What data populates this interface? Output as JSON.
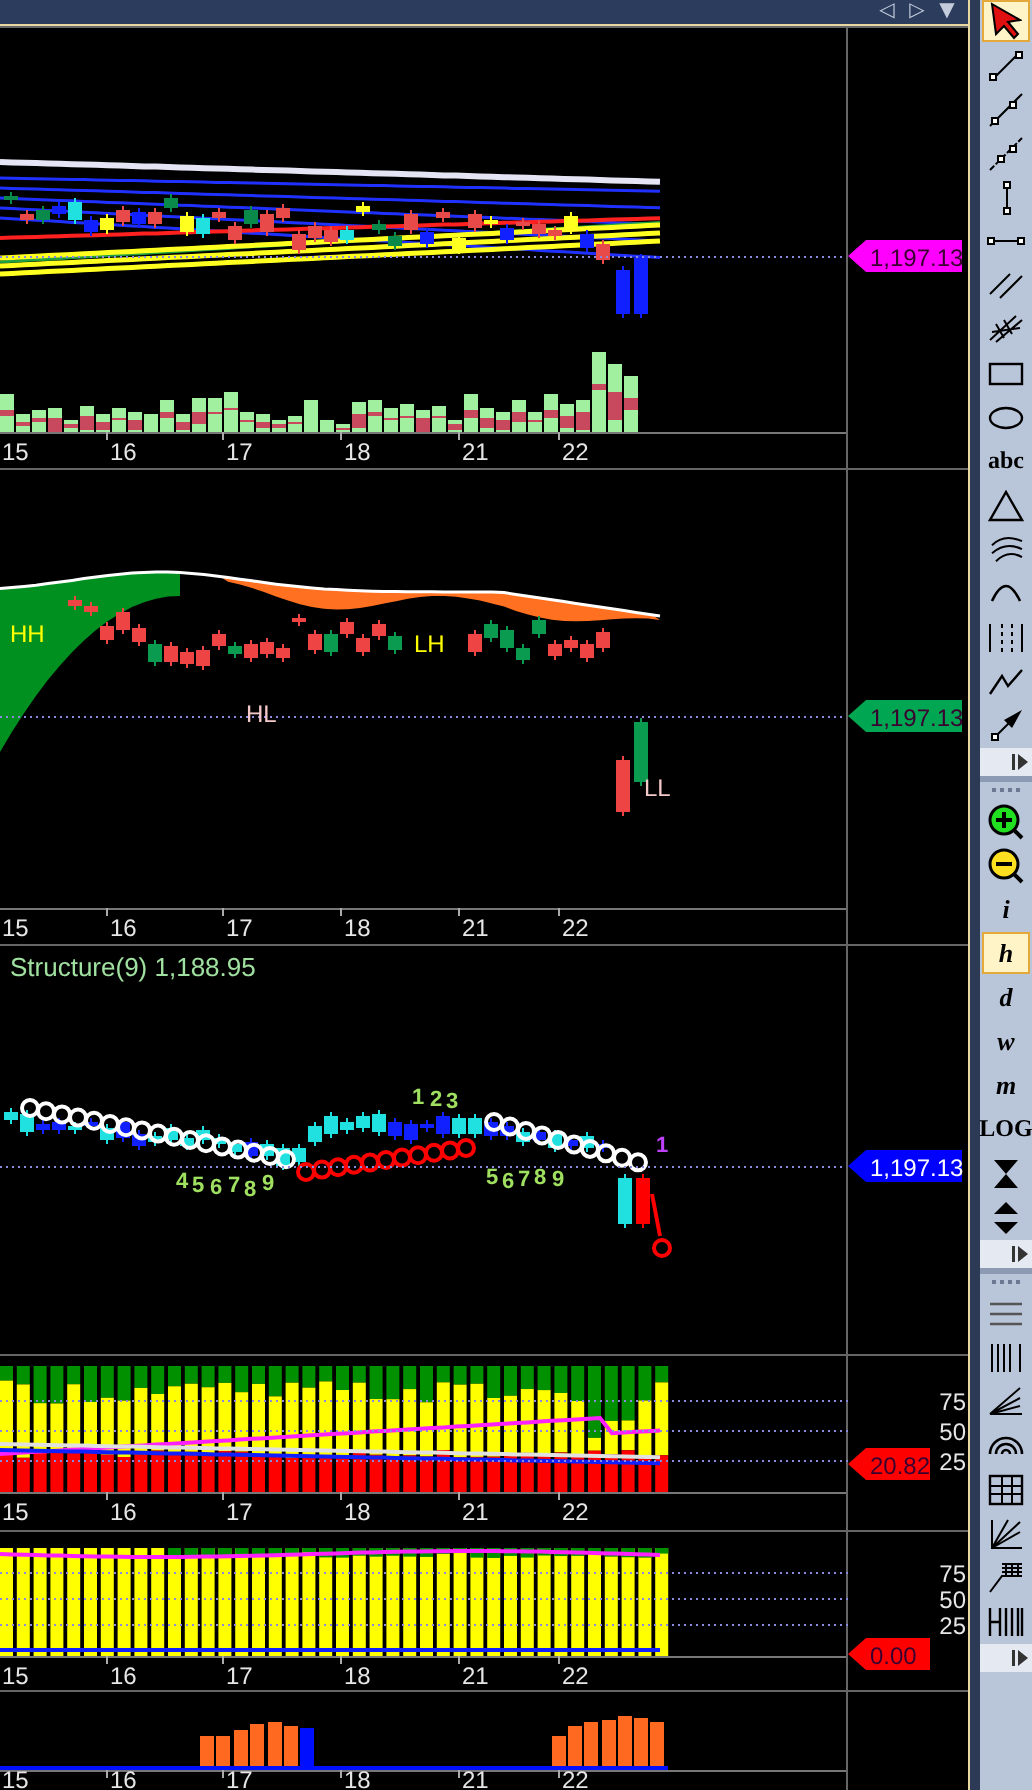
{
  "nav_buttons": [
    {
      "label": "◁"
    },
    {
      "label": "▷"
    },
    {
      "label": "▼"
    }
  ],
  "panels": [
    {
      "kind": "ribbon",
      "dates": [
        "15",
        "16",
        "17",
        "18",
        "21",
        "22"
      ],
      "price_tag": {
        "text": "1,197.13",
        "color": "#ff00ff"
      }
    },
    {
      "kind": "swing",
      "dates": [
        "15",
        "16",
        "17",
        "18",
        "21",
        "22"
      ],
      "swing_labels": [
        {
          "text": "HH",
          "kind": "high"
        },
        {
          "text": "LH",
          "kind": "high"
        },
        {
          "text": "HL",
          "kind": "low"
        },
        {
          "text": "LL",
          "kind": "low"
        }
      ],
      "price_tag": {
        "text": "1,197.13",
        "color": "#00a651"
      }
    },
    {
      "kind": "structure",
      "title": "Structure(9) 1,188.95",
      "count_labels": [
        {
          "text": "4",
          "color": "#a0e060"
        },
        {
          "text": "5",
          "color": "#a0e060"
        },
        {
          "text": "6",
          "color": "#a0e060"
        },
        {
          "text": "7",
          "color": "#a0e060"
        },
        {
          "text": "8",
          "color": "#a0e060"
        },
        {
          "text": "9",
          "color": "#a0e060"
        },
        {
          "text": "1",
          "color": "#a0e060"
        },
        {
          "text": "2",
          "color": "#a0e060"
        },
        {
          "text": "3",
          "color": "#a0e060"
        },
        {
          "text": "5",
          "color": "#a0e060"
        },
        {
          "text": "6",
          "color": "#a0e060"
        },
        {
          "text": "7",
          "color": "#a0e060"
        },
        {
          "text": "8",
          "color": "#a0e060"
        },
        {
          "text": "9",
          "color": "#a0e060"
        },
        {
          "text": "1",
          "color": "#c040ff"
        }
      ],
      "price_tag": {
        "text": "1,197.13",
        "color": "#0000ff"
      }
    },
    {
      "kind": "bands",
      "dates": [
        "15",
        "16",
        "17",
        "18",
        "21",
        "22"
      ],
      "y_ticks": [
        "75",
        "50",
        "25"
      ],
      "value_tag": {
        "text": "20.82",
        "color": "#ff0000"
      }
    },
    {
      "kind": "bands_full",
      "dates": [
        "15",
        "16",
        "17",
        "18",
        "21",
        "22"
      ],
      "y_ticks": [
        "75",
        "50",
        "25"
      ],
      "value_tag": {
        "text": "0.00",
        "color": "#ff0000"
      }
    },
    {
      "kind": "histogram",
      "dates": [
        "15",
        "16",
        "17",
        "18",
        "21",
        "22"
      ]
    }
  ],
  "toolbar": [
    {
      "kind": "icon",
      "selected": true
    },
    {
      "kind": "icon",
      "selected": false
    },
    {
      "kind": "icon",
      "selected": false
    },
    {
      "kind": "icon",
      "selected": false
    },
    {
      "kind": "icon",
      "selected": false
    },
    {
      "kind": "icon",
      "selected": false
    },
    {
      "kind": "icon",
      "selected": false
    },
    {
      "kind": "icon",
      "selected": false
    },
    {
      "kind": "icon",
      "selected": false
    },
    {
      "kind": "icon",
      "selected": false
    },
    {
      "kind": "text",
      "label": "abc",
      "selected": false
    },
    {
      "kind": "icon",
      "selected": false
    },
    {
      "kind": "icon",
      "selected": false
    },
    {
      "kind": "icon",
      "selected": false
    },
    {
      "kind": "icon",
      "selected": false
    },
    {
      "kind": "icon",
      "selected": false
    },
    {
      "kind": "icon",
      "selected": false
    },
    {
      "kind": "expander"
    },
    {
      "kind": "grip"
    },
    {
      "kind": "icon",
      "selected": false
    },
    {
      "kind": "icon",
      "selected": false
    },
    {
      "kind": "text",
      "label": "i",
      "selected": false
    },
    {
      "kind": "text",
      "label": "h",
      "selected": true
    },
    {
      "kind": "text",
      "label": "d",
      "selected": false
    },
    {
      "kind": "text",
      "label": "w",
      "selected": false
    },
    {
      "kind": "text",
      "label": "m",
      "selected": false
    },
    {
      "kind": "text",
      "label": "LOG",
      "selected": false
    },
    {
      "kind": "icon",
      "selected": false
    },
    {
      "kind": "icon",
      "selected": false
    },
    {
      "kind": "expander"
    },
    {
      "kind": "grip"
    },
    {
      "kind": "icon",
      "selected": false
    },
    {
      "kind": "icon",
      "selected": false
    },
    {
      "kind": "icon",
      "selected": false
    },
    {
      "kind": "icon",
      "selected": false
    },
    {
      "kind": "icon",
      "selected": false
    },
    {
      "kind": "icon",
      "selected": false
    },
    {
      "kind": "icon",
      "selected": false
    },
    {
      "kind": "icon",
      "selected": false
    },
    {
      "kind": "expander"
    }
  ]
}
